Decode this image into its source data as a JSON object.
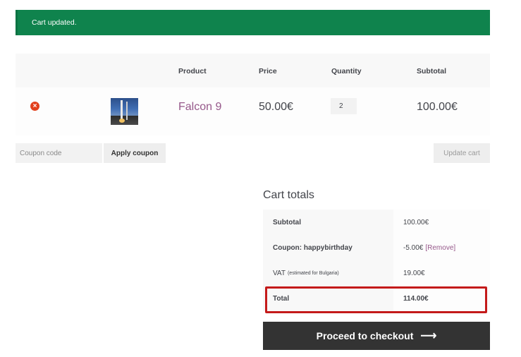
{
  "notice": {
    "message": "Cart updated."
  },
  "table": {
    "headers": {
      "product": "Product",
      "price": "Price",
      "quantity": "Quantity",
      "subtotal": "Subtotal"
    },
    "rows": [
      {
        "remove_icon": "close-circle-icon",
        "product_name": "Falcon 9",
        "price": "50.00€",
        "quantity": "2",
        "subtotal": "100.00€"
      }
    ]
  },
  "coupon": {
    "placeholder": "Coupon code",
    "apply_label": "Apply coupon"
  },
  "update_label": "Update cart",
  "totals": {
    "heading": "Cart totals",
    "subtotal_label": "Subtotal",
    "subtotal_value": "100.00€",
    "coupon_label": "Coupon: happybirthday",
    "coupon_value": "-5.00€",
    "coupon_remove": "[Remove]",
    "vat_label": "VAT",
    "vat_note": "(estimated for Bulgaria)",
    "vat_value": "19.00€",
    "total_label": "Total",
    "total_value": "114.00€"
  },
  "checkout": {
    "label": "Proceed to checkout",
    "arrow": "⟶"
  },
  "colors": {
    "notice_bg": "#0f834d",
    "link": "#96588a",
    "highlight": "#c41a1a",
    "checkout_bg": "#333333"
  }
}
